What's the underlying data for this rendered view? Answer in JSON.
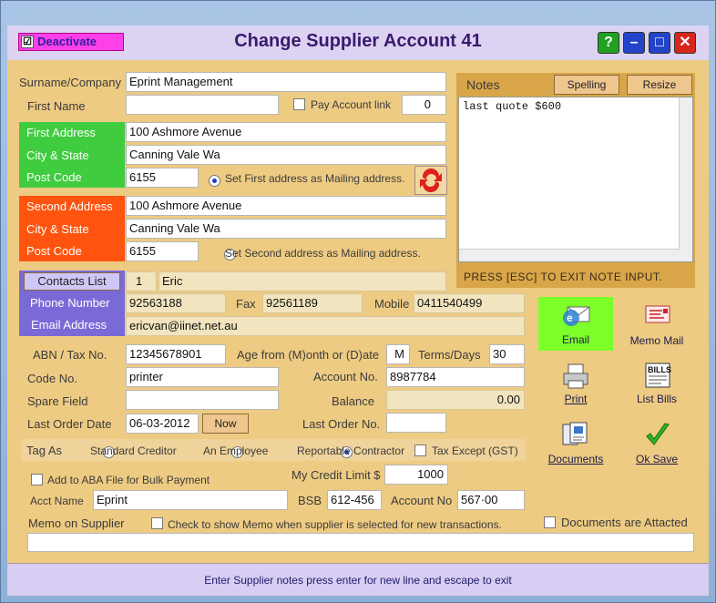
{
  "window": {
    "title": "Change Supplier Account 41",
    "deactivate": "Deactivate",
    "deactivate_checked": "☑"
  },
  "controls": {
    "help": "?",
    "minimize": "–",
    "maximize": "□",
    "close": "✕"
  },
  "supplier": {
    "surname_label": "Surname/Company",
    "surname": "Eprint Management",
    "first_name_label": "First Name",
    "first_name": "",
    "pay_account_label": "Pay Account link",
    "pay_account_value": "0",
    "first_address_label": "First Address",
    "first_address": "100 Ashmore Avenue",
    "city_state_label": "City & State",
    "first_city": "Canning Vale  Wa",
    "postcode_label": "Post Code",
    "first_postcode": "6155",
    "set_first_label": "Set First address as Mailing address.",
    "second_address_label": "Second Address",
    "second_address": "100 Ashmore Avenue",
    "second_city": "Canning Vale  Wa",
    "second_postcode": "6155",
    "set_second_label": "Set Second address as Mailing address."
  },
  "contacts": {
    "list_button": "Contacts List",
    "index": "1",
    "name": "Eric",
    "phone_label": "Phone Number",
    "phone": "92563188",
    "fax_label": "Fax",
    "fax": "92561189",
    "mobile_label": "Mobile",
    "mobile": "0411540499",
    "email_label": "Email Address",
    "email": "ericvan@iinet.net.au"
  },
  "account": {
    "abn_label": "ABN / Tax No.",
    "abn": "12345678901",
    "age_label": "Age from (M)onth or (D)ate",
    "age": "M",
    "terms_label": "Terms/Days",
    "terms": "30",
    "code_label": "Code No.",
    "code": "printer",
    "account_no_label": "Account No.",
    "account_no": "8987784",
    "spare_label": "Spare Field",
    "spare": "",
    "balance_label": "Balance",
    "balance": "0.00",
    "last_order_date_label": "Last Order Date",
    "last_order_date": "06-03-2012",
    "now_button": "Now",
    "last_order_no_label": "Last Order No.",
    "last_order_no": ""
  },
  "tag": {
    "label": "Tag As",
    "standard": "Standard Creditor",
    "employee": "An Employee",
    "reportable": "Reportable Contractor",
    "tax_except": "Tax Except (GST)"
  },
  "bank": {
    "aba_label": "Add to ABA File for Bulk Payment",
    "credit_limit_label": "My Credit Limit $",
    "credit_limit": "1000",
    "acct_name_label": "Acct Name",
    "acct_name": "Eprint",
    "bsb_label": "BSB",
    "bsb": "612-456",
    "account_no_label": "Account No",
    "account_no": "567·00"
  },
  "memo": {
    "label": "Memo on Supplier",
    "check_label": "Check to show Memo when supplier is selected for new transactions.",
    "documents_attached": "Documents are Attacted",
    "value": ""
  },
  "notes": {
    "title": "Notes",
    "spelling": "Spelling",
    "resize": "Resize",
    "text": "last quote $600",
    "footer": "PRESS  [ESC]  TO  EXIT NOTE  INPUT."
  },
  "actions": {
    "email": "Email",
    "memo_mail": "Memo Mail",
    "print": "Print",
    "list_bills": "List Bills",
    "documents": "Documents",
    "ok_save": "Ok Save"
  },
  "status": "Enter Supplier notes press enter for new line and escape to exit"
}
